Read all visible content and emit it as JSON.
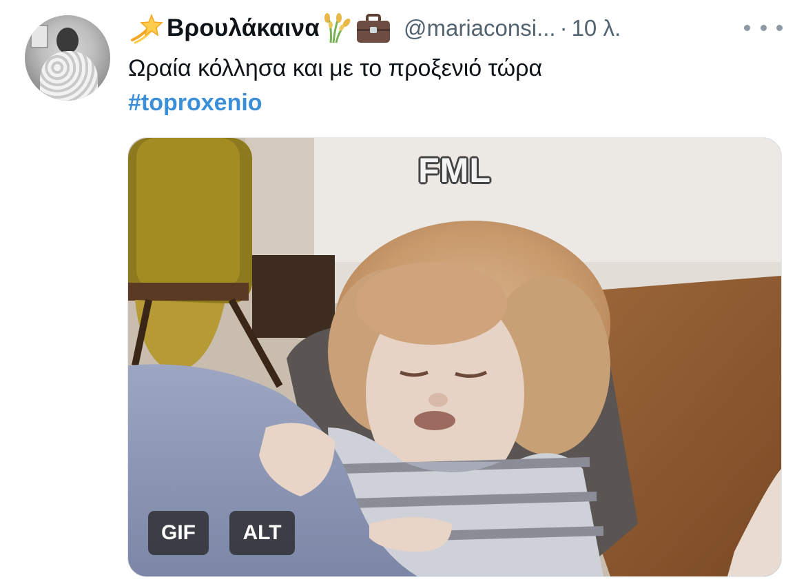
{
  "tweet": {
    "display_name": "Βρουλάκαινα",
    "handle": "@mariaconsi...",
    "separator": "·",
    "time": "10 λ.",
    "text": "Ωραία κόλλησα και με το προξενιό τώρα",
    "hashtag": "#toproxenio",
    "icons": {
      "name_prefix": "dizzy-star-emoji",
      "name_suffix_1": "sheaf-of-rice-emoji",
      "name_suffix_2": "briefcase-emoji",
      "more": "more-options-icon"
    }
  },
  "media": {
    "caption": "FML",
    "gif_badge": "GIF",
    "alt_badge": "ALT"
  },
  "colors": {
    "text": "#0f1419",
    "secondary": "#536471",
    "hashtag": "#3b8fd8"
  }
}
